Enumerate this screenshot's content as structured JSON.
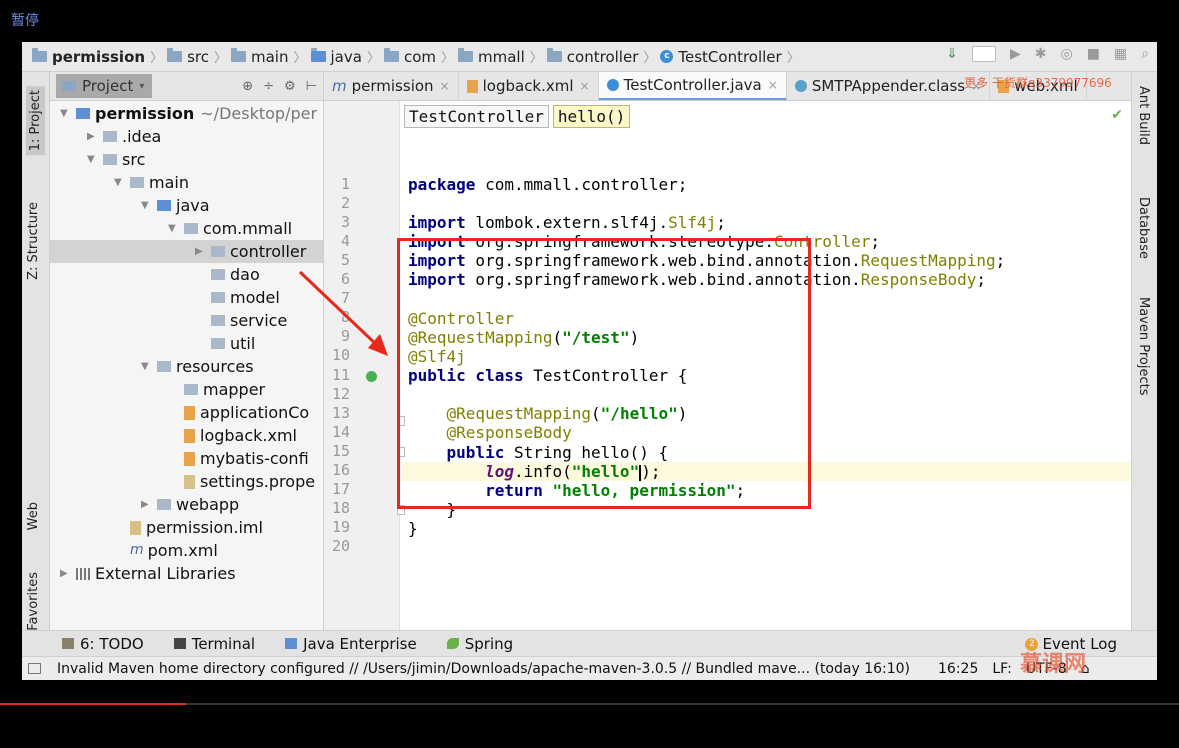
{
  "player": {
    "pause_label": "暂停",
    "progress_fraction": 0.158
  },
  "navbar": {
    "crumbs": [
      "permission",
      "src",
      "main",
      "java",
      "com",
      "mmall",
      "controller",
      "TestController"
    ]
  },
  "left_strip": {
    "project": "1: Project",
    "structure": "Z: Structure",
    "web": "Web",
    "favorites": "2: Favorites"
  },
  "right_strip": {
    "ant": "Ant Build",
    "database": "Database",
    "maven": "Maven Projects"
  },
  "project_panel": {
    "tab_label": "Project",
    "tree": [
      {
        "label": "permission",
        "path": "~/Desktop/per",
        "depth": 0,
        "kind": "module",
        "bold": true
      },
      {
        "label": ".idea",
        "depth": 1,
        "kind": "folder"
      },
      {
        "label": "src",
        "depth": 1,
        "kind": "folder"
      },
      {
        "label": "main",
        "depth": 2,
        "kind": "folder"
      },
      {
        "label": "java",
        "depth": 3,
        "kind": "source"
      },
      {
        "label": "com.mmall",
        "depth": 4,
        "kind": "package"
      },
      {
        "label": "controller",
        "depth": 5,
        "kind": "package",
        "selected": true
      },
      {
        "label": "dao",
        "depth": 5,
        "kind": "package"
      },
      {
        "label": "model",
        "depth": 5,
        "kind": "package"
      },
      {
        "label": "service",
        "depth": 5,
        "kind": "package"
      },
      {
        "label": "util",
        "depth": 5,
        "kind": "package"
      },
      {
        "label": "resources",
        "depth": 3,
        "kind": "folder"
      },
      {
        "label": "mapper",
        "depth": 4,
        "kind": "folder"
      },
      {
        "label": "applicationCo",
        "depth": 4,
        "kind": "xml"
      },
      {
        "label": "logback.xml",
        "depth": 4,
        "kind": "xml"
      },
      {
        "label": "mybatis-confi",
        "depth": 4,
        "kind": "xml"
      },
      {
        "label": "settings.prope",
        "depth": 4,
        "kind": "file"
      },
      {
        "label": "webapp",
        "depth": 3,
        "kind": "folder"
      },
      {
        "label": "permission.iml",
        "depth": 2,
        "kind": "file"
      },
      {
        "label": "pom.xml",
        "depth": 2,
        "kind": "maven"
      },
      {
        "label": "External Libraries",
        "depth": 0,
        "kind": "lib"
      }
    ]
  },
  "editor_tabs": [
    {
      "label": "permission",
      "type": "maven"
    },
    {
      "label": "logback.xml",
      "type": "xml"
    },
    {
      "label": "TestController.java",
      "type": "class",
      "active": true
    },
    {
      "label": "SMTPAppender.class",
      "type": "class"
    },
    {
      "label": "web.xml",
      "type": "xml"
    }
  ],
  "editor": {
    "breadcrumbs": [
      "TestController",
      "hello()"
    ],
    "cursor_line": 16,
    "line_numbers": [
      "1",
      "2",
      "3",
      "4",
      "5",
      "6",
      "7",
      "8",
      "9",
      "10",
      "11",
      "12",
      "13",
      "14",
      "15",
      "16",
      "17",
      "18",
      "19",
      "20"
    ],
    "lines": {
      "l1_kw": "package",
      "l1_rest": " com.mmall.controller;",
      "l3_kw": "import",
      "l3_a": " lombok.extern.slf4j.",
      "l3_b": "Slf4j",
      "l3_c": ";",
      "l4_kw": "import",
      "l4_a": " org.springframework.stereotype.",
      "l4_b": "Controller",
      "l4_c": ";",
      "l5_kw": "import",
      "l5_a": " org.springframework.web.bind.annotation.",
      "l5_b": "RequestMapping",
      "l5_c": ";",
      "l6_kw": "import",
      "l6_a": " org.springframework.web.bind.annotation.",
      "l6_b": "ResponseBody",
      "l6_c": ";",
      "l8_ann": "@Controller",
      "l9_ann": "@RequestMapping",
      "l9_a": "(",
      "l9_str": "\"/test\"",
      "l9_b": ")",
      "l10_ann": "@Slf4j",
      "l11_kw": "public class",
      "l11_rest": " TestController {",
      "l13_ann": "@RequestMapping",
      "l13_a": "(",
      "l13_str": "\"/hello\"",
      "l13_b": ")",
      "l14_ann": "@ResponseBody",
      "l15_kw": "public",
      "l15_rest": " String hello() {",
      "l16_log": "log",
      "l16_a": ".info(",
      "l16_str": "\"hello\"",
      "l16_b": ");",
      "l17_kw": "return",
      "l17_str": " \"hello, permission\"",
      "l17_b": ";",
      "l18": "}",
      "l19": "}"
    }
  },
  "bottom_toolbar": {
    "todo": "6: TODO",
    "terminal": "Terminal",
    "java_enterprise": "Java Enterprise",
    "spring": "Spring",
    "event_log": "Event Log",
    "event_count": "2"
  },
  "statusbar": {
    "message": "Invalid Maven home directory configured // /Users/jimin/Downloads/apache-maven-3.0.5 // Bundled mave... (today 16:10)",
    "position": "16:25",
    "line_sep": "LF:",
    "encoding": "UTF-8"
  },
  "watermarks": {
    "top": "更多  干货群q3379977696",
    "logo": "慕课网"
  },
  "colors": {
    "annotation_box": "#e8281c",
    "keyword": "#000080",
    "annotation": "#808000",
    "string": "#008000",
    "active_tab_underline": "#6a9ae0"
  }
}
